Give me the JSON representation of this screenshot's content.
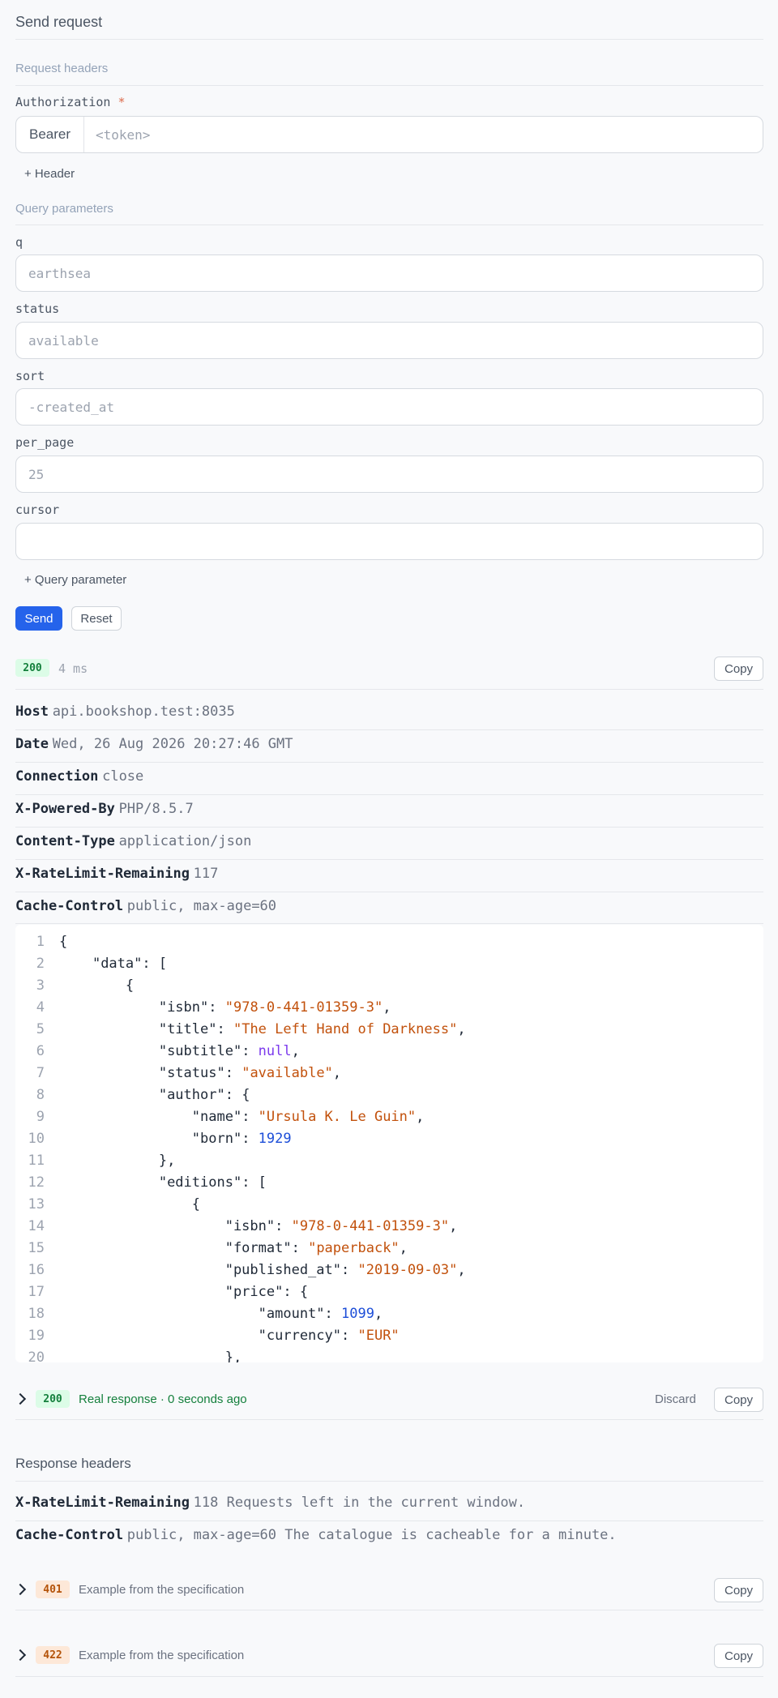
{
  "header": {
    "title": "Send request"
  },
  "request_headers": {
    "section_label": "Request headers",
    "authorization": {
      "label": "Authorization",
      "required_mark": "*",
      "prefix": "Bearer",
      "placeholder": "<token>"
    },
    "add_header_label": "+ Header"
  },
  "query_params": {
    "section_label": "Query parameters",
    "fields": [
      {
        "label": "q",
        "placeholder": "earthsea"
      },
      {
        "label": "status",
        "placeholder": "available"
      },
      {
        "label": "sort",
        "placeholder": "-created_at"
      },
      {
        "label": "per_page",
        "placeholder": "25"
      },
      {
        "label": "cursor",
        "placeholder": ""
      }
    ],
    "add_param_label": "+ Query parameter"
  },
  "actions": {
    "send_label": "Send",
    "reset_label": "Reset"
  },
  "response": {
    "status": "200",
    "time": "4 ms",
    "copy_label": "Copy",
    "headers": [
      {
        "name": "Host",
        "value": "api.bookshop.test:8035"
      },
      {
        "name": "Date",
        "value": "Wed, 26 Aug 2026 20:27:46 GMT"
      },
      {
        "name": "Connection",
        "value": "close"
      },
      {
        "name": "X-Powered-By",
        "value": "PHP/8.5.7"
      },
      {
        "name": "Content-Type",
        "value": "application/json"
      },
      {
        "name": "X-RateLimit-Remaining",
        "value": "117"
      },
      {
        "name": "Cache-Control",
        "value": "public, max-age=60"
      }
    ],
    "body_lines": [
      {
        "n": "1",
        "indent": "",
        "parts": [
          {
            "t": "punc",
            "v": "{"
          }
        ]
      },
      {
        "n": "2",
        "indent": "    ",
        "parts": [
          {
            "t": "key",
            "v": "\"data\""
          },
          {
            "t": "punc",
            "v": ": ["
          }
        ]
      },
      {
        "n": "3",
        "indent": "        ",
        "parts": [
          {
            "t": "punc",
            "v": "{"
          }
        ]
      },
      {
        "n": "4",
        "indent": "            ",
        "parts": [
          {
            "t": "key",
            "v": "\"isbn\""
          },
          {
            "t": "punc",
            "v": ": "
          },
          {
            "t": "str",
            "v": "\"978-0-441-01359-3\""
          },
          {
            "t": "punc",
            "v": ","
          }
        ]
      },
      {
        "n": "5",
        "indent": "            ",
        "parts": [
          {
            "t": "key",
            "v": "\"title\""
          },
          {
            "t": "punc",
            "v": ": "
          },
          {
            "t": "str",
            "v": "\"The Left Hand of Darkness\""
          },
          {
            "t": "punc",
            "v": ","
          }
        ]
      },
      {
        "n": "6",
        "indent": "            ",
        "parts": [
          {
            "t": "key",
            "v": "\"subtitle\""
          },
          {
            "t": "punc",
            "v": ": "
          },
          {
            "t": "null",
            "v": "null"
          },
          {
            "t": "punc",
            "v": ","
          }
        ]
      },
      {
        "n": "7",
        "indent": "            ",
        "parts": [
          {
            "t": "key",
            "v": "\"status\""
          },
          {
            "t": "punc",
            "v": ": "
          },
          {
            "t": "str",
            "v": "\"available\""
          },
          {
            "t": "punc",
            "v": ","
          }
        ]
      },
      {
        "n": "8",
        "indent": "            ",
        "parts": [
          {
            "t": "key",
            "v": "\"author\""
          },
          {
            "t": "punc",
            "v": ": {"
          }
        ]
      },
      {
        "n": "9",
        "indent": "                ",
        "parts": [
          {
            "t": "key",
            "v": "\"name\""
          },
          {
            "t": "punc",
            "v": ": "
          },
          {
            "t": "str",
            "v": "\"Ursula K. Le Guin\""
          },
          {
            "t": "punc",
            "v": ","
          }
        ]
      },
      {
        "n": "10",
        "indent": "                ",
        "parts": [
          {
            "t": "key",
            "v": "\"born\""
          },
          {
            "t": "punc",
            "v": ": "
          },
          {
            "t": "num",
            "v": "1929"
          }
        ]
      },
      {
        "n": "11",
        "indent": "            ",
        "parts": [
          {
            "t": "punc",
            "v": "},"
          }
        ]
      },
      {
        "n": "12",
        "indent": "            ",
        "parts": [
          {
            "t": "key",
            "v": "\"editions\""
          },
          {
            "t": "punc",
            "v": ": ["
          }
        ]
      },
      {
        "n": "13",
        "indent": "                ",
        "parts": [
          {
            "t": "punc",
            "v": "{"
          }
        ]
      },
      {
        "n": "14",
        "indent": "                    ",
        "parts": [
          {
            "t": "key",
            "v": "\"isbn\""
          },
          {
            "t": "punc",
            "v": ": "
          },
          {
            "t": "str",
            "v": "\"978-0-441-01359-3\""
          },
          {
            "t": "punc",
            "v": ","
          }
        ]
      },
      {
        "n": "15",
        "indent": "                    ",
        "parts": [
          {
            "t": "key",
            "v": "\"format\""
          },
          {
            "t": "punc",
            "v": ": "
          },
          {
            "t": "str",
            "v": "\"paperback\""
          },
          {
            "t": "punc",
            "v": ","
          }
        ]
      },
      {
        "n": "16",
        "indent": "                    ",
        "parts": [
          {
            "t": "key",
            "v": "\"published_at\""
          },
          {
            "t": "punc",
            "v": ": "
          },
          {
            "t": "str",
            "v": "\"2019-09-03\""
          },
          {
            "t": "punc",
            "v": ","
          }
        ]
      },
      {
        "n": "17",
        "indent": "                    ",
        "parts": [
          {
            "t": "key",
            "v": "\"price\""
          },
          {
            "t": "punc",
            "v": ": {"
          }
        ]
      },
      {
        "n": "18",
        "indent": "                        ",
        "parts": [
          {
            "t": "key",
            "v": "\"amount\""
          },
          {
            "t": "punc",
            "v": ": "
          },
          {
            "t": "num",
            "v": "1099"
          },
          {
            "t": "punc",
            "v": ","
          }
        ]
      },
      {
        "n": "19",
        "indent": "                        ",
        "parts": [
          {
            "t": "key",
            "v": "\"currency\""
          },
          {
            "t": "punc",
            "v": ": "
          },
          {
            "t": "str",
            "v": "\"EUR\""
          }
        ]
      },
      {
        "n": "20",
        "indent": "                    ",
        "parts": [
          {
            "t": "punc",
            "v": "},"
          }
        ]
      }
    ]
  },
  "saved_response": {
    "status": "200",
    "text": "Real response · 0 seconds ago",
    "discard_label": "Discard",
    "copy_label": "Copy",
    "headers_title": "Response headers",
    "headers": [
      {
        "name": "X-RateLimit-Remaining",
        "value": "118 Requests left in the current window."
      },
      {
        "name": "Cache-Control",
        "value": "public, max-age=60 The catalogue is cacheable for a minute."
      }
    ]
  },
  "examples": [
    {
      "status": "401",
      "text": "Example from the specification",
      "copy_label": "Copy"
    },
    {
      "status": "422",
      "text": "Example from the specification",
      "copy_label": "Copy"
    }
  ],
  "colors": {
    "primary": "#2563eb",
    "success": "#15803d",
    "warning": "#b45309"
  }
}
